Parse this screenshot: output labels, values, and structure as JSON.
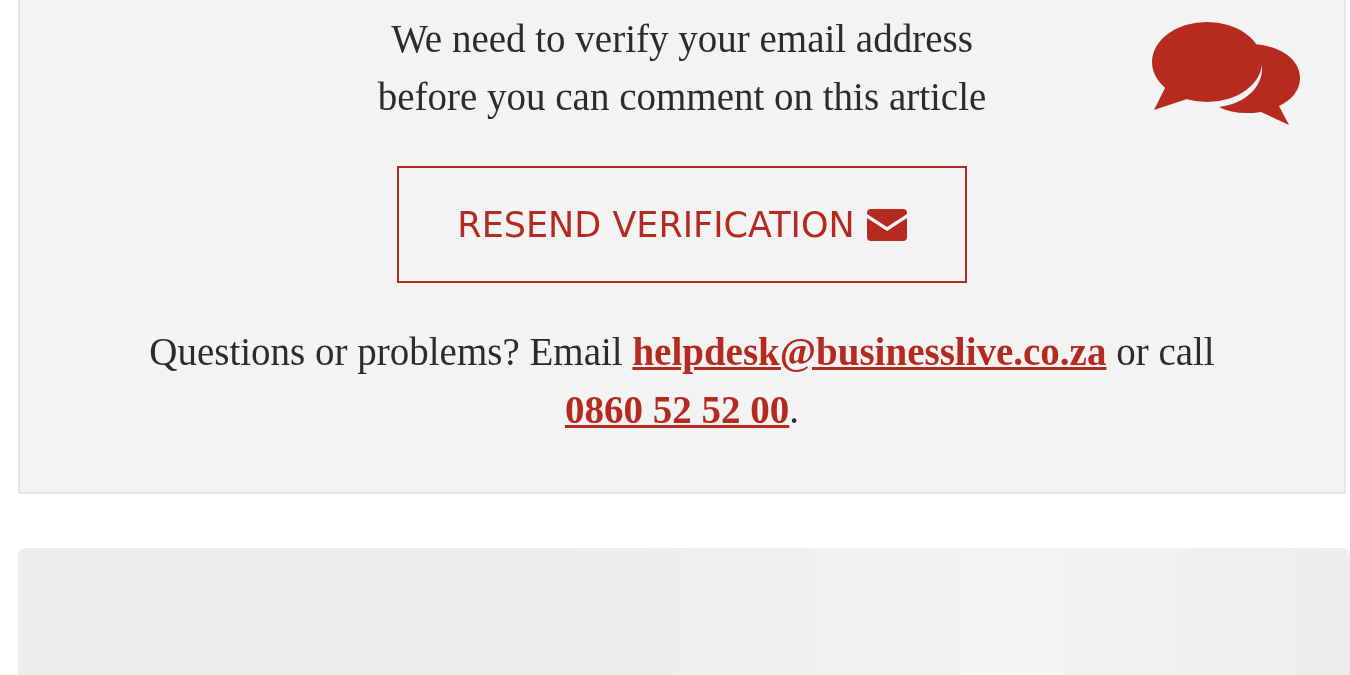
{
  "notice": {
    "lines": [
      "We need to verify your email address",
      "before you can comment on this article"
    ]
  },
  "button": {
    "label": "RESEND VERIFICATION"
  },
  "help": {
    "text_before": "Questions or problems? Email ",
    "email": "helpdesk@businesslive.co.za",
    "text_middle": " or call ",
    "phone": "0860 52 52 00",
    "text_after": "."
  }
}
